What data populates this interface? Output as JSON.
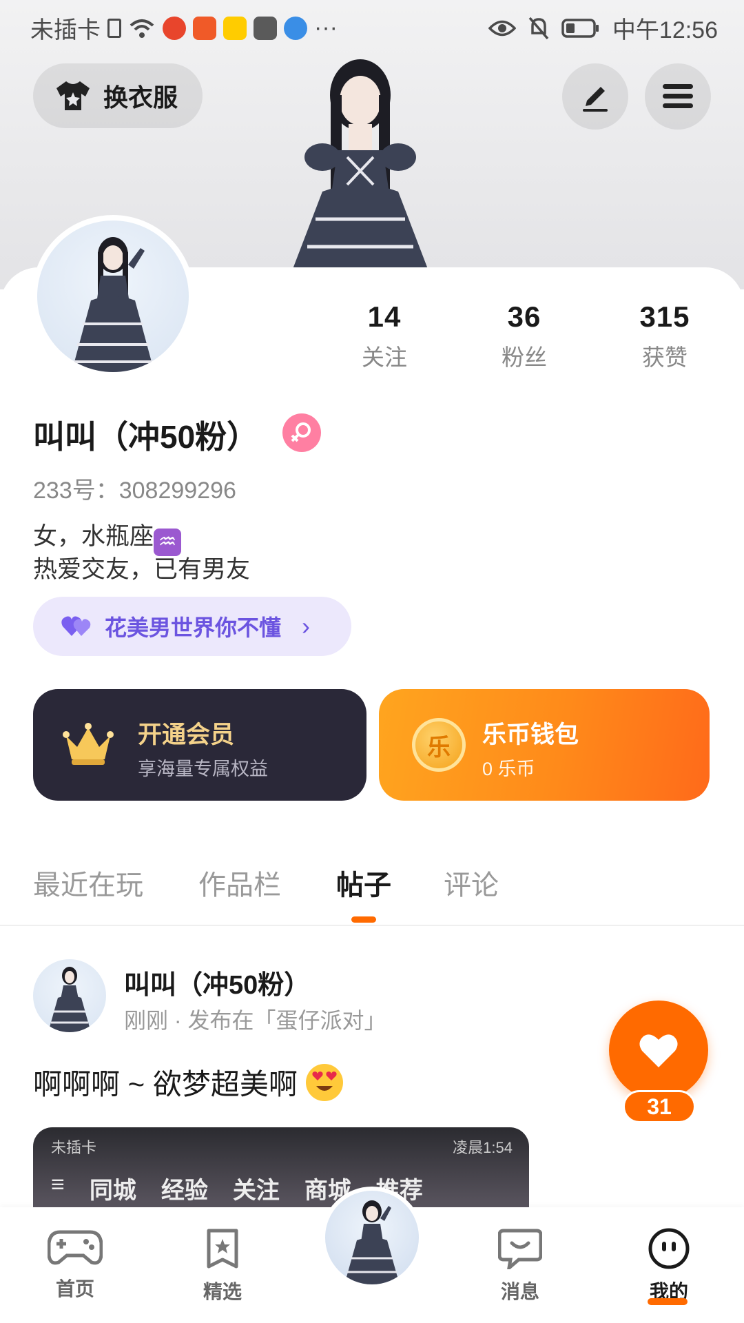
{
  "status_bar": {
    "carrier": "未插卡",
    "more": "···",
    "time": "中午12:56"
  },
  "header": {
    "dress_button_label": "换衣服"
  },
  "profile": {
    "stats": [
      {
        "value": "14",
        "label": "关注"
      },
      {
        "value": "36",
        "label": "粉丝"
      },
      {
        "value": "315",
        "label": "获赞"
      }
    ],
    "name": "叫叫（冲50粉）",
    "uid": "233号：308299296",
    "bio_line1": "女，水瓶座",
    "bio_zodiac_symbol": "♒",
    "bio_line2": "热爱交友，已有男友",
    "club_label": "花美男世界你不懂",
    "club_chevron": "›"
  },
  "cards": {
    "vip_title": "开通会员",
    "vip_subtitle": "享海量专属权益",
    "wallet_title": "乐币钱包",
    "wallet_subtitle": "0 乐币",
    "wallet_coin_char": "乐"
  },
  "tabs": [
    {
      "label": "最近在玩",
      "active": false
    },
    {
      "label": "作品栏",
      "active": false
    },
    {
      "label": "帖子",
      "active": true
    },
    {
      "label": "评论",
      "active": false
    }
  ],
  "post": {
    "author": "叫叫（冲50粉）",
    "meta": "刚刚 · 发布在「蛋仔派对」",
    "text": "啊啊啊 ~ 欲梦超美啊",
    "like_count": "31",
    "screenshot": {
      "carrier": "未插卡",
      "time": "凌晨1:54",
      "tabs": [
        "同城",
        "经验",
        "关注",
        "商城",
        "推荐"
      ]
    }
  },
  "bottom_nav": [
    {
      "label": "首页",
      "icon": "gamepad-icon",
      "active": false
    },
    {
      "label": "精选",
      "icon": "star-bookmark-icon",
      "active": false
    },
    {
      "label": "",
      "icon": "avatar-center",
      "active": false
    },
    {
      "label": "消息",
      "icon": "chat-bubble-icon",
      "active": false
    },
    {
      "label": "我的",
      "icon": "face-icon",
      "active": true
    }
  ],
  "colors": {
    "accent": "#ff6a00",
    "gender_badge": "#ff7fa2",
    "club_text": "#6b54e0",
    "vip_bg": "#2a2838",
    "vip_gold": "#f4d28a"
  }
}
